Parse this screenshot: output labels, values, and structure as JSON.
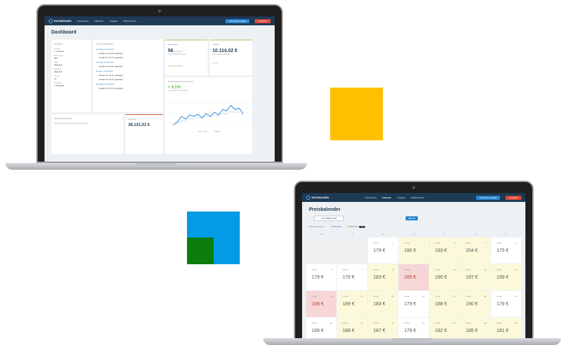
{
  "app": {
    "logo_text": "RATEBOARD",
    "nav_items": [
      "Dashboard",
      "Kalender",
      "Analyse",
      "Mitbewerber"
    ],
    "nav_button_primary": "EINSTELLUNGEN",
    "nav_button_secondary": "LOGOUT"
  },
  "dashboard": {
    "title": "Dashboard",
    "summary_card": {
      "title": "Übersicht",
      "rows": [
        {
          "k": "Umsatz",
          "v": "1.774,00 €"
        },
        {
          "k": "Buchungen",
          "v": "365"
        },
        {
          "k": "ADR",
          "v": "250,00 €"
        },
        {
          "k": "RevPAR",
          "v": "250,00 €"
        },
        {
          "k": "Zimmer",
          "v": "14"
        },
        {
          "k": "Kapazität",
          "v": "1.750,00 €"
        }
      ]
    },
    "recommendations_card": {
      "title": "Preisempfehlungen",
      "groups": [
        {
          "date": "Samstag, 22.10.2016",
          "items": [
            "Umsatz am 22.10. gestiegen",
            "Umsatz am 23.10. gestiegen"
          ]
        },
        {
          "date": "Sonntag, 23.10.2016",
          "items": [
            "Umsatz am 23.10. gestiegen"
          ]
        },
        {
          "date": "Montag, 24.10.2016",
          "items": [
            "Umsatz am 24.10. gestiegen",
            "Umsatz am 25.10. gestiegen"
          ]
        },
        {
          "date": "Dienstag, 25.10.2016",
          "items": [
            "Umsatz am 25.10. gestiegen"
          ]
        }
      ]
    },
    "bookings_card": {
      "title": "Buchungen",
      "value": "56",
      "unit": "Buchungen",
      "note": "in den letzten 30 Tagen"
    },
    "revenue_card": {
      "title": "Umsatz",
      "value": "10.114,02 €",
      "note": "in den letzten 30 Tagen"
    },
    "bookings_link": "zu den Buchungen",
    "revenue_delta": "+ 5,1 %",
    "trend_card": {
      "title": "Umsatzentwicklung 30 Tage",
      "value": "+ 5,1%",
      "note": "im Vergleich zum Vorjahr",
      "legend": [
        "Dieses Jahr",
        "Vorjahr"
      ]
    },
    "info_card": {
      "title": "Ratenanpassungen",
      "text": "Die Preise wurden automatisch angepasst."
    },
    "forecast_card": {
      "title": "Forecast",
      "value": "38.131,02 €"
    }
  },
  "calendar": {
    "title": "Preiskalender",
    "month": "OKTOBER 2016",
    "today_label": "HEUTE",
    "tabs": {
      "label": "Zimmerkategorie:",
      "active": "STANDARD",
      "other": "SUPERIOR",
      "count": "12"
    },
    "weekdays": [
      "Mo",
      "Di",
      "Mi",
      "Do",
      "Fr",
      "Sa",
      "So"
    ],
    "rows": [
      [
        {
          "s": "g",
          "base": "",
          "day": "",
          "price": ""
        },
        {
          "s": "g",
          "base": "",
          "day": "",
          "price": ""
        },
        {
          "s": "w",
          "base": "179 €",
          "day": "1",
          "price": "179 €"
        },
        {
          "s": "y",
          "base": "179 €",
          "day": "2",
          "price": "190 €"
        },
        {
          "s": "y",
          "base": "179 €",
          "day": "3",
          "price": "193 €"
        },
        {
          "s": "y",
          "base": "179 €",
          "day": "4",
          "price": "204 €"
        },
        {
          "s": "w",
          "base": "179 €",
          "day": "5",
          "price": "175 €"
        }
      ],
      [
        {
          "s": "w",
          "base": "179 €",
          "day": "6",
          "price": "179 €"
        },
        {
          "s": "w",
          "base": "179 €",
          "day": "7",
          "price": "170 €"
        },
        {
          "s": "y",
          "base": "179 €",
          "day": "8",
          "price": "183 €"
        },
        {
          "s": "r",
          "base": "179 €",
          "day": "9",
          "price": "165 €"
        },
        {
          "s": "y",
          "base": "179 €",
          "day": "10",
          "price": "190 €"
        },
        {
          "s": "y",
          "base": "179 €",
          "day": "11",
          "price": "197 €"
        },
        {
          "s": "y",
          "base": "179 €",
          "day": "12",
          "price": "199 €"
        }
      ],
      [
        {
          "s": "r",
          "base": "179 €",
          "day": "13",
          "price": "168 €"
        },
        {
          "s": "y",
          "base": "179 €",
          "day": "14",
          "price": "189 €"
        },
        {
          "s": "y",
          "base": "179 €",
          "day": "15",
          "price": "183 €"
        },
        {
          "s": "w",
          "base": "179 €",
          "day": "16",
          "price": "179 €"
        },
        {
          "s": "y",
          "base": "179 €",
          "day": "17",
          "price": "188 €"
        },
        {
          "s": "y",
          "base": "179 €",
          "day": "18",
          "price": "190 €"
        },
        {
          "s": "w",
          "base": "179 €",
          "day": "19",
          "price": "179 €"
        }
      ],
      [
        {
          "s": "w",
          "base": "179 €",
          "day": "20",
          "price": "169 €"
        },
        {
          "s": "y",
          "base": "179 €",
          "day": "21",
          "price": "188 €"
        },
        {
          "s": "y",
          "base": "179 €",
          "day": "22",
          "price": "187 €"
        },
        {
          "s": "w",
          "base": "179 €",
          "day": "23",
          "price": "179 €"
        },
        {
          "s": "y",
          "base": "179 €",
          "day": "24",
          "price": "182 €"
        },
        {
          "s": "y",
          "base": "179 €",
          "day": "25",
          "price": "185 €"
        },
        {
          "s": "y",
          "base": "179 €",
          "day": "26",
          "price": "181 €"
        }
      ]
    ]
  },
  "colors": {
    "navy": "#1d3a55",
    "accent_blue": "#2a86d1",
    "yellow_square": "#ffc000",
    "blue_square": "#039be5",
    "green_square": "#0a7d0a"
  }
}
